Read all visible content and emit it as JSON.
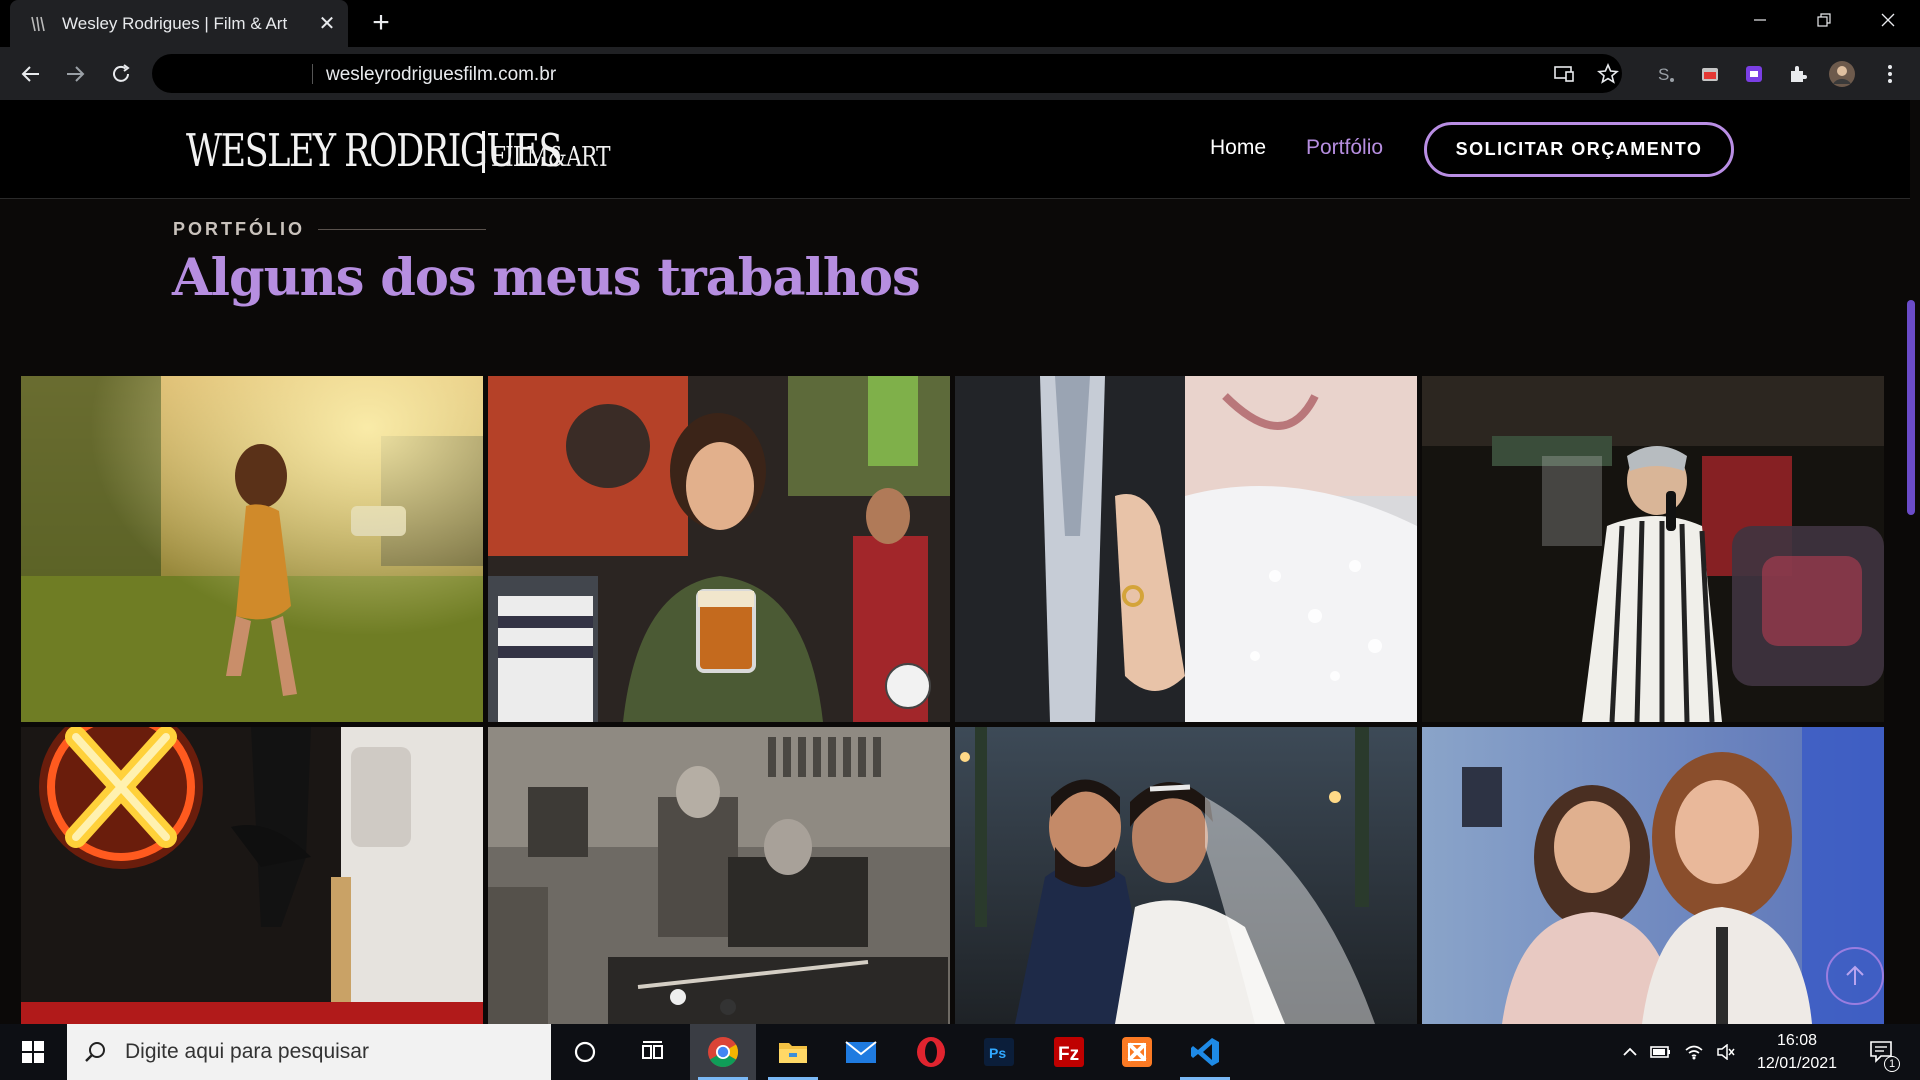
{
  "browser": {
    "tab_title": "Wesley Rodrigues | Film & Art",
    "url": "wesleyrodriguesfilm.com.br"
  },
  "site": {
    "logo_main": "WESLEY RODRIGUES",
    "logo_sub": "FILM&ART",
    "nav": {
      "home": "Home",
      "portfolio": "Portfólio",
      "cta": "SOLICITAR ORÇAMENTO"
    },
    "accent_color": "#b68ee0"
  },
  "section": {
    "kicker": "PORTFÓLIO",
    "title": "Alguns dos meus trabalhos"
  },
  "gallery": [
    {
      "icon": "photo-woman-in-field-sunset"
    },
    {
      "icon": "photo-woman-holding-beer-in-bar"
    },
    {
      "icon": "photo-wedding-ring-hand-on-suit"
    },
    {
      "icon": "photo-singer-with-microphone"
    },
    {
      "icon": "photo-neon-x-gym-workout"
    },
    {
      "icon": "photo-black-white-pool-bar"
    },
    {
      "icon": "photo-bride-and-groom-embrace"
    },
    {
      "icon": "photo-two-women-smiling-party"
    }
  ],
  "taskbar": {
    "search_placeholder": "Digite aqui para pesquisar",
    "time": "16:08",
    "date": "12/01/2021",
    "notification_count": "1"
  }
}
